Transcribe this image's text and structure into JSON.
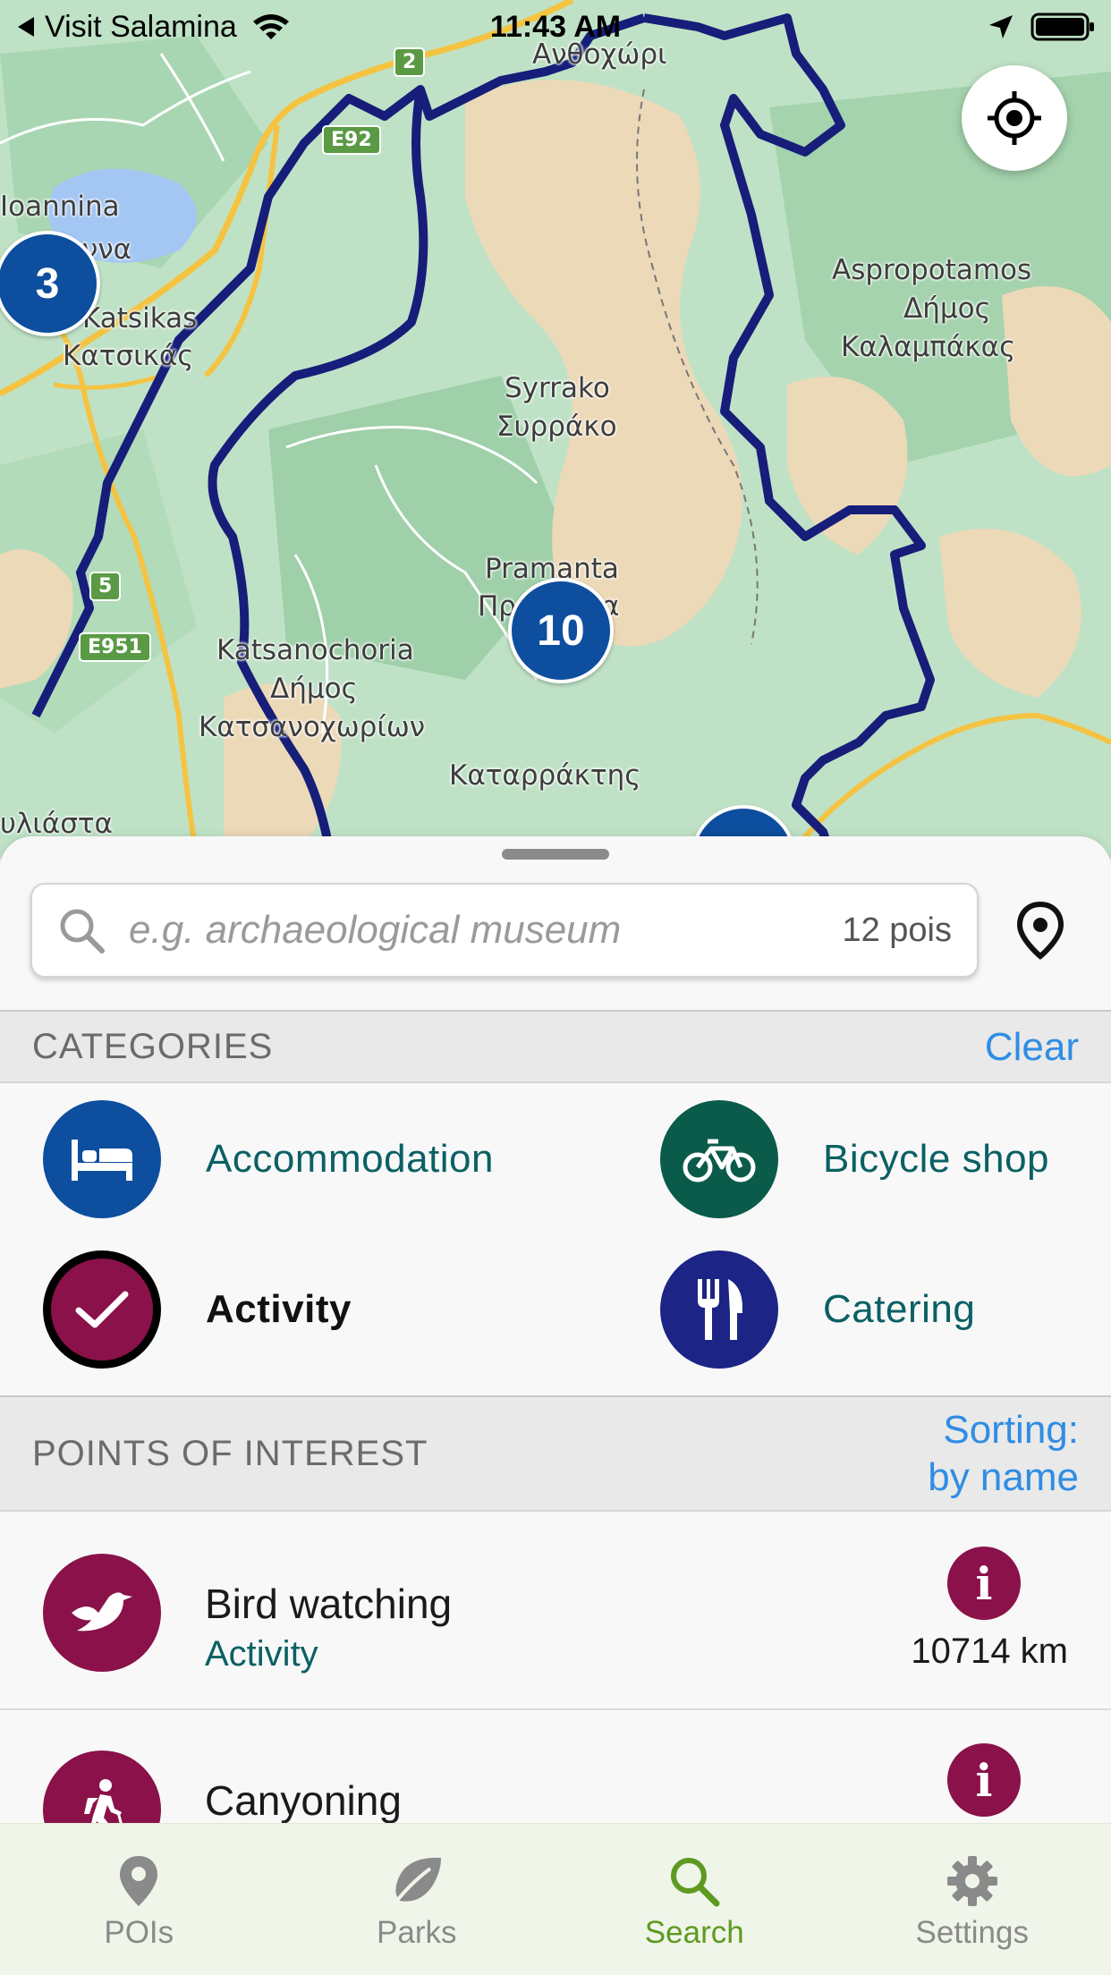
{
  "status_bar": {
    "back_app": "Visit Salamina",
    "time": "11:43 AM"
  },
  "map": {
    "labels": {
      "anthochori": "Ανθοχώρι",
      "ioannina": "Ioannina",
      "ioannina_gr": "ννα",
      "katsikas": "Katsikas",
      "katsikas_gr": "Κατσικάς",
      "aspropotamos": "Aspropotamos",
      "aspropotamos_dimos": "Δήμος",
      "aspropotamos_gr": "Καλαμπάκας",
      "syrrako": "Syrrako",
      "syrrako_gr": "Συρράκο",
      "pramanta": "Pramanta",
      "pramanta_gr": "Πρ",
      "pramanta_gr_tail": "α",
      "katsanochoria": "Katsanochoria",
      "katsanochoria_dimos": "Δήμος",
      "katsanochoria_gr": "Κατσανοχωρίων",
      "katarraktis": "Καταρράκτης",
      "vouliasta": "υλιάστα"
    },
    "road_shields": {
      "r2": "2",
      "e92": "E92",
      "r5": "5",
      "e951": "E951"
    },
    "clusters": {
      "c3": "3",
      "c10": "10"
    },
    "colors": {
      "land": "#bfe2c6",
      "mountain": "#ecd9b8",
      "boundary": "#161e7a",
      "road": "#f5c342",
      "cluster": "#0d4e9e"
    }
  },
  "search": {
    "placeholder": "e.g. archaeological museum",
    "value": "",
    "count": "12 pois"
  },
  "categories": {
    "title": "CATEGORIES",
    "clear": "Clear",
    "items": [
      {
        "label": "Accommodation",
        "icon": "bed-icon",
        "color": "#0d4e9e",
        "selected": false
      },
      {
        "label": "Bicycle shop",
        "icon": "bicycle-icon",
        "color": "#0a5b4a",
        "selected": false
      },
      {
        "label": "Activity",
        "icon": "checkmark-icon",
        "color": "#8a1149",
        "selected": true
      },
      {
        "label": "Catering",
        "icon": "fork-knife-icon",
        "color": "#1c2485",
        "selected": false
      }
    ]
  },
  "pois": {
    "title": "POINTS OF INTEREST",
    "sorting_line1": "Sorting:",
    "sorting_line2": "by name",
    "items": [
      {
        "name": "Bird watching",
        "category": "Activity",
        "distance": "10714 km",
        "icon": "bird-icon",
        "info": "i"
      },
      {
        "name": "Canyoning",
        "category": "",
        "distance": "",
        "icon": "hiker-icon",
        "info": "i"
      }
    ]
  },
  "tabs": [
    {
      "label": "POIs",
      "icon": "pin-icon",
      "active": false
    },
    {
      "label": "Parks",
      "icon": "leaf-icon",
      "active": false
    },
    {
      "label": "Search",
      "icon": "search-icon",
      "active": true
    },
    {
      "label": "Settings",
      "icon": "gear-icon",
      "active": false
    }
  ]
}
